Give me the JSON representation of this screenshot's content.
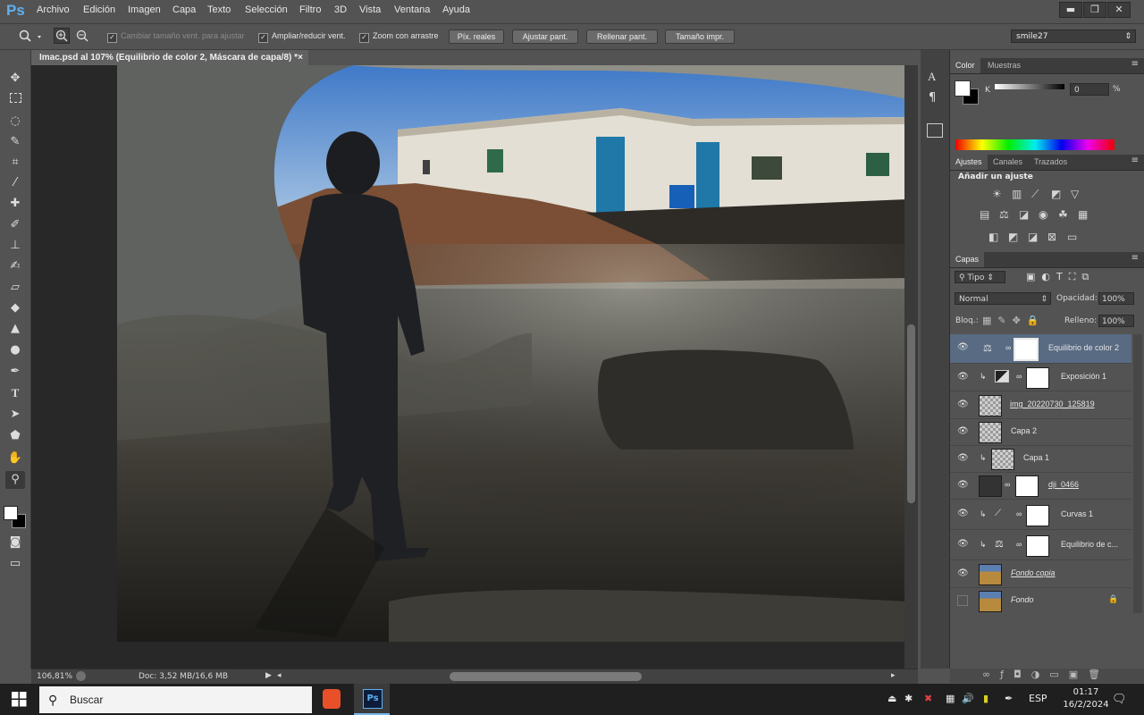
{
  "app": {
    "logo": "Ps"
  },
  "menu": [
    "Archivo",
    "Edición",
    "Imagen",
    "Capa",
    "Texto",
    "Selección",
    "Filtro",
    "3D",
    "Vista",
    "Ventana",
    "Ayuda"
  ],
  "window_buttons": {
    "minimize": "▬",
    "restore": "❐",
    "close": "✕"
  },
  "options": {
    "resize_windows": "Cambiar tamaño vent. para ajustar",
    "zoom_all": "Ampliar/reducir vent.",
    "scrubby": "Zoom con arrastre",
    "btn_actual": "Píx. reales",
    "btn_fit": "Ajustar pant.",
    "btn_fill": "Rellenar pant.",
    "btn_print": "Tamaño impr.",
    "workspace": "smile27"
  },
  "document": {
    "tab_title": "Imac.psd al 107% (Equilibrio de color 2, Máscara de capa/8) *",
    "close": "×"
  },
  "status": {
    "zoom": "106,81%",
    "doc": "Doc: 3,52 MB/16,6 MB"
  },
  "color_panel": {
    "tabs": [
      "Color",
      "Muestras"
    ],
    "channel": "K",
    "value": "0",
    "unit": "%"
  },
  "adjustments_panel": {
    "tabs": [
      "Ajustes",
      "Canales",
      "Trazados"
    ],
    "title": "Añadir un ajuste"
  },
  "layers_panel": {
    "tab": "Capas",
    "filter": "Tipo",
    "blend_mode": "Normal",
    "opacity_label": "Opacidad:",
    "opacity": "100%",
    "lock_label": "Bloq.:",
    "fill_label": "Relleno:",
    "fill": "100%",
    "layers": [
      {
        "name": "Equilibrio de color 2"
      },
      {
        "name": "Exposición 1"
      },
      {
        "name": "img_20220730_125819"
      },
      {
        "name": "Capa 2"
      },
      {
        "name": "Capa 1"
      },
      {
        "name": "dji_0466"
      },
      {
        "name": "Curvas 1"
      },
      {
        "name": "Equilibrio de c..."
      },
      {
        "name": "Fondo copia"
      },
      {
        "name": "Fondo"
      }
    ]
  },
  "taskbar": {
    "search": "Buscar",
    "lang": "ESP",
    "time": "01:17",
    "date": "16/2/2024",
    "ps_label": "Ps"
  },
  "colors": {
    "accent": "#5fb0f0",
    "selected_layer": "#596b83",
    "sky": "#3f79c8"
  }
}
